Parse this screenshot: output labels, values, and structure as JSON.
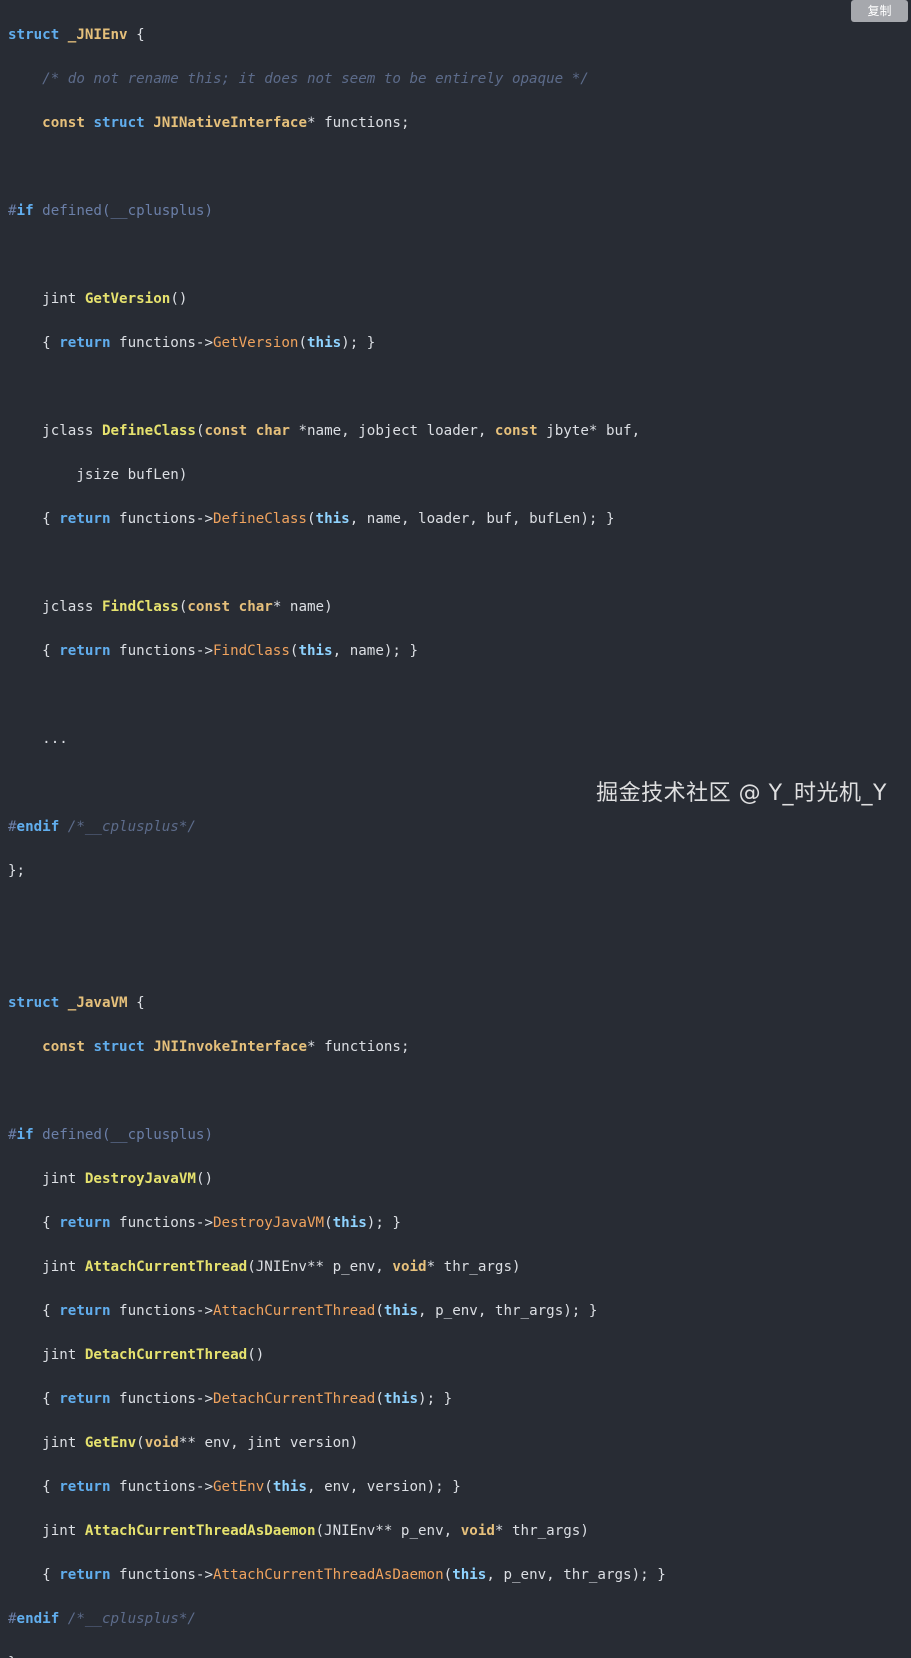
{
  "toolbar": {
    "copy_label": "复制"
  },
  "watermark": {
    "text": "掘金技术社区 @ Y_时光机_Y"
  },
  "code": {
    "struct_jnienv": "struct",
    "jnienv_name": "_JNIEnv",
    "brace_open": " {",
    "comment_opaque": "/* do not rename this; it does not seem to be entirely opaque */",
    "l3_const": "const",
    "l3_struct": "struct",
    "l3_type": "JNINativeInterface",
    "l3_rest": "* functions;",
    "if_hash": "#",
    "if_kw": "if",
    "if_defined": " defined(__cplusplus)",
    "getversion_type": "jint ",
    "getversion_fn": "GetVersion",
    "getversion_params": "()",
    "getversion_body_open": "{ ",
    "return_kw": "return",
    "functions_arrow": " functions->",
    "getversion_call": "GetVersion",
    "paren_open": "(",
    "this_kw": "this",
    "getversion_tail": "); }",
    "defineclass_type": "jclass ",
    "defineclass_fn": "DefineClass",
    "defineclass_p1": "(",
    "defineclass_const1": "const",
    "defineclass_char": "char",
    "defineclass_p2": " *name, jobject loader, ",
    "defineclass_const2": "const",
    "defineclass_p3": " jbyte* buf,",
    "defineclass_line2": "        jsize bufLen)",
    "defineclass_call": "DefineClass",
    "defineclass_tail": ", name, loader, buf, bufLen); }",
    "findclass_type": "jclass ",
    "findclass_fn": "FindClass",
    "findclass_const": "const",
    "findclass_char": "char",
    "findclass_p": "* name)",
    "findclass_call": "FindClass",
    "findclass_tail": ", name); }",
    "ellipsis": "    ...",
    "endif_hash": "#",
    "endif_kw": "endif",
    "endif_comment": " /*__cplusplus*/",
    "close_brace": "};",
    "struct_javavm": "struct",
    "javavm_name": "_JavaVM",
    "jvm_const": "const",
    "jvm_struct": "struct",
    "jvm_type": "JNIInvokeInterface",
    "jvm_rest": "* functions;",
    "destroy_type": "jint ",
    "destroy_fn": "DestroyJavaVM",
    "destroy_params": "()",
    "destroy_call": "DestroyJavaVM",
    "destroy_tail": "); }",
    "attach_type": "jint ",
    "attach_fn": "AttachCurrentThread",
    "attach_p1": "(JNIEnv** p_env, ",
    "void_kw": "void",
    "attach_p2": "* thr_args)",
    "attach_call": "AttachCurrentThread",
    "attach_tail": ", p_env, thr_args); }",
    "detach_type": "jint ",
    "detach_fn": "DetachCurrentThread",
    "detach_params": "()",
    "detach_call": "DetachCurrentThread",
    "detach_tail": "); }",
    "getenv_type": "jint ",
    "getenv_fn": "GetEnv",
    "getenv_p1": "(",
    "getenv_void": "void",
    "getenv_p2": "** env, jint version)",
    "getenv_call": "GetEnv",
    "getenv_tail": ", env, version); }",
    "daemon_type": "jint ",
    "daemon_fn": "AttachCurrentThreadAsDaemon",
    "daemon_p1": "(JNIEnv** p_env, ",
    "daemon_void": "void",
    "daemon_p2": "* thr_args)",
    "daemon_call": "AttachCurrentThreadAsDaemon",
    "daemon_tail": ", p_env, thr_args); }"
  }
}
